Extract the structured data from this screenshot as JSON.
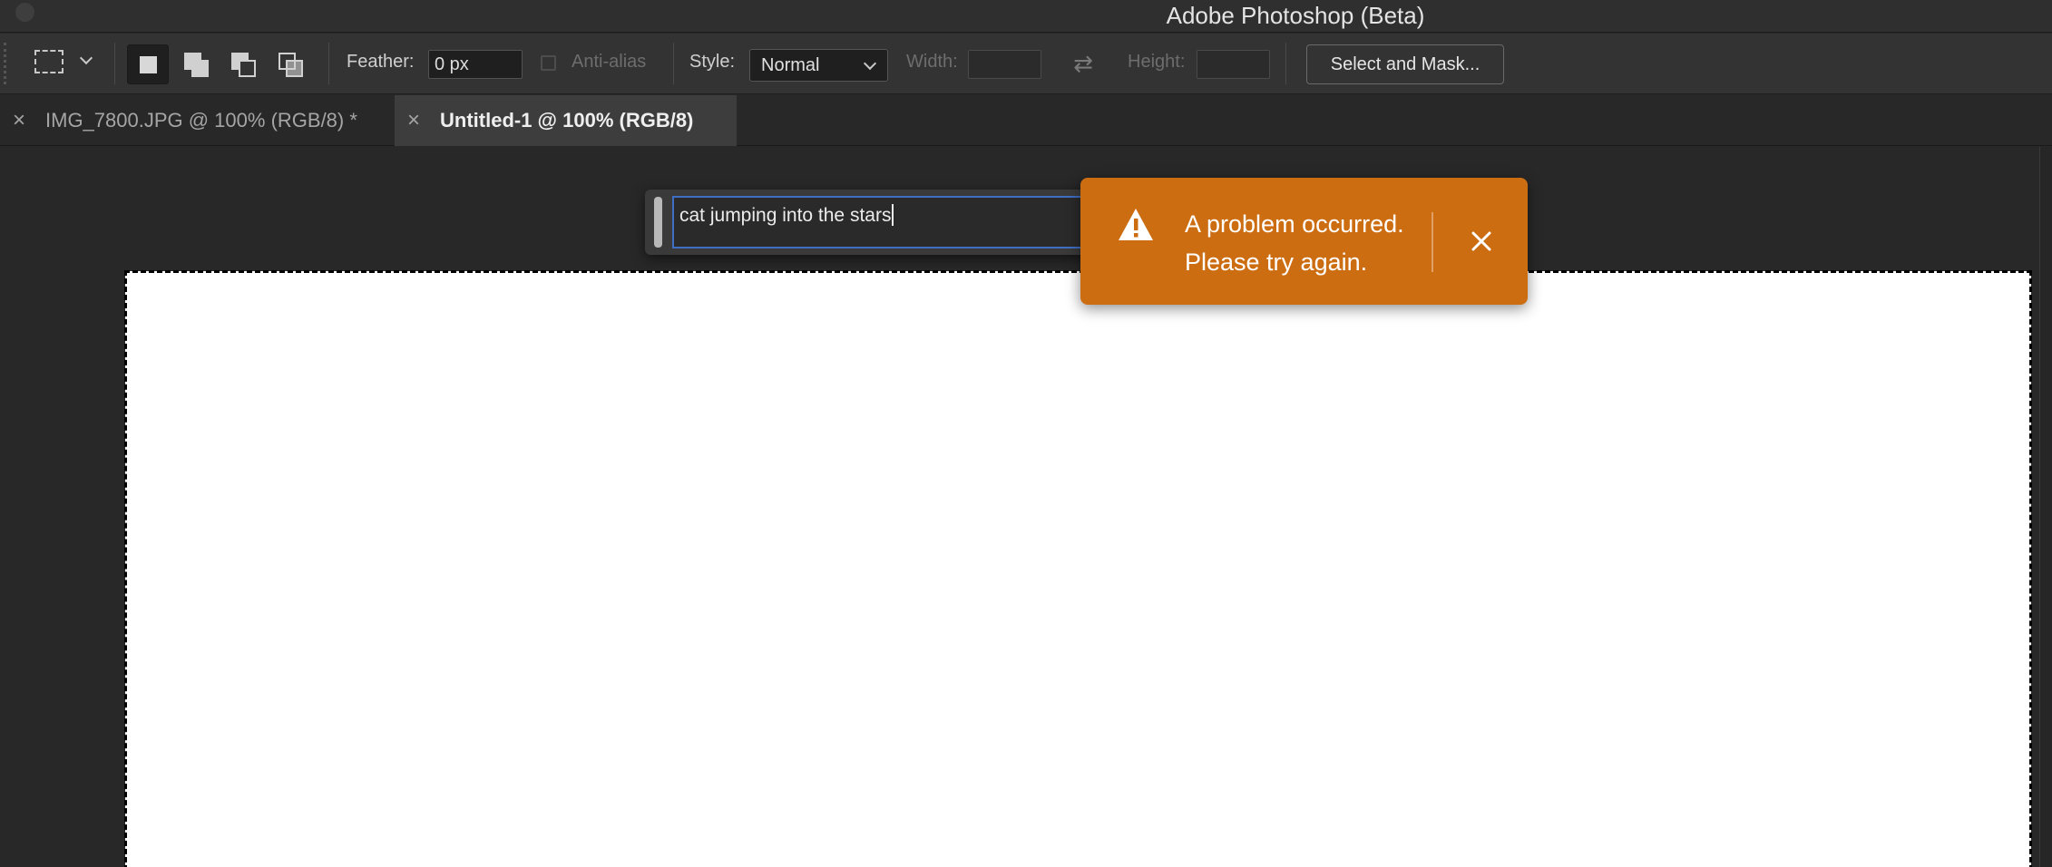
{
  "window": {
    "title": "Adobe Photoshop (Beta)"
  },
  "options_bar": {
    "feather_label": "Feather:",
    "feather_value": "0 px",
    "anti_alias_label": "Anti-alias",
    "style_label": "Style:",
    "style_value": "Normal",
    "width_label": "Width:",
    "height_label": "Height:",
    "select_mask_label": "Select and Mask..."
  },
  "tabs": [
    {
      "label": "IMG_7800.JPG @ 100% (RGB/8) *",
      "close": "×",
      "active": false
    },
    {
      "label": "Untitled-1 @ 100% (RGB/8)",
      "close": "×",
      "active": true
    }
  ],
  "prompt": {
    "value": "cat jumping into the stars"
  },
  "toast": {
    "line1": "A problem occurred.",
    "line2": "Please try again.",
    "icon": "warning-icon",
    "color": "#cc6d12"
  },
  "colors": {
    "selection_accent": "#3f6fc4",
    "canvas": "#ffffff",
    "workspace": "#282828"
  }
}
